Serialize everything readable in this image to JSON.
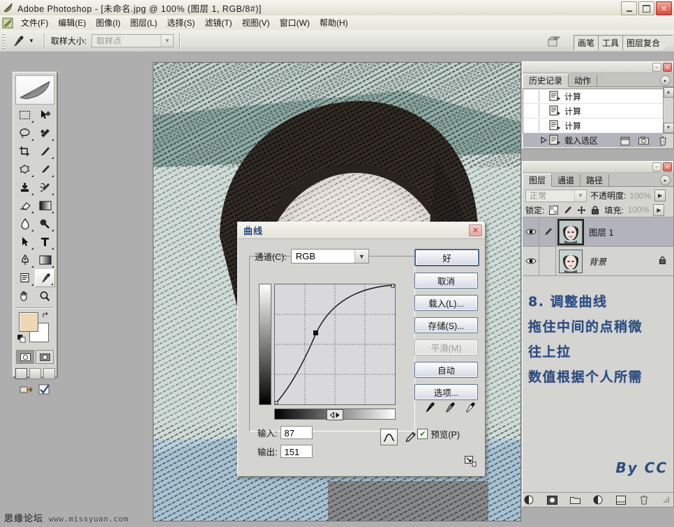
{
  "window": {
    "title": "Adobe Photoshop - [未命名.jpg @ 100% (图层 1, RGB/8#)]",
    "app_icon": "photoshop-feather-icon",
    "buttons": {
      "minimize": "minimize-icon",
      "maximize": "maximize-icon",
      "close": "close-icon"
    }
  },
  "menubar": {
    "items": [
      {
        "label": "文件(F)"
      },
      {
        "label": "编辑(E)"
      },
      {
        "label": "图像(I)"
      },
      {
        "label": "图层(L)"
      },
      {
        "label": "选择(S)"
      },
      {
        "label": "滤镜(T)"
      },
      {
        "label": "视图(V)"
      },
      {
        "label": "窗口(W)"
      },
      {
        "label": "帮助(H)"
      }
    ]
  },
  "options_bar": {
    "tool_icon": "eyedropper-icon",
    "sample_size_label": "取样大小:",
    "sample_size_value": "取样点",
    "palette_well": [
      "画笔",
      "工具",
      "图层复合"
    ]
  },
  "toolbox": {
    "tools": [
      "marquee-rectangular-icon",
      "move-icon",
      "lasso-icon",
      "magic-wand-icon",
      "crop-icon",
      "slice-icon",
      "healing-brush-icon",
      "brush-icon",
      "clone-stamp-icon",
      "history-brush-icon",
      "eraser-icon",
      "gradient-icon",
      "blur-icon",
      "dodge-icon",
      "path-selection-icon",
      "type-icon",
      "pen-icon",
      "shape-rectangle-icon",
      "notes-icon",
      "eyedropper-icon",
      "hand-icon",
      "zoom-icon"
    ],
    "selected_tool": "eyedropper-icon",
    "foreground_color": "#efd7b6",
    "background_color": "#ffffff",
    "swap_colors_icon": "swap-colors-icon",
    "default_colors_icon": "default-colors-icon",
    "quick_mask": [
      "standard-mode-icon",
      "quick-mask-mode-icon"
    ],
    "screen_modes": [
      "standard-screen-icon",
      "full-screen-menubar-icon",
      "full-screen-icon"
    ],
    "jump_to": [
      "jump-to-imageready-icon",
      "jump-to-check-icon"
    ]
  },
  "history_palette": {
    "tabs": [
      {
        "label": "历史记录",
        "active": true
      },
      {
        "label": "动作",
        "active": false
      }
    ],
    "menu_icon": "palette-menu-icon",
    "items": [
      {
        "label": "计算",
        "selected": false,
        "icon": "history-state-icon"
      },
      {
        "label": "计算",
        "selected": false,
        "icon": "history-state-icon"
      },
      {
        "label": "计算",
        "selected": false,
        "icon": "history-state-icon"
      },
      {
        "label": "载入选区",
        "selected": true,
        "icon": "history-state-icon"
      }
    ],
    "footer_icons": [
      "new-document-from-state-icon",
      "new-snapshot-icon",
      "delete-state-icon"
    ]
  },
  "layers_palette": {
    "tabs": [
      {
        "label": "图层",
        "active": true
      },
      {
        "label": "通道",
        "active": false
      },
      {
        "label": "路径",
        "active": false
      }
    ],
    "menu_icon": "palette-menu-icon",
    "blend_mode": "正常",
    "opacity_label": "不透明度:",
    "opacity_value": "100%",
    "lock_label": "锁定:",
    "lock_icons": [
      "lock-transparency-icon",
      "lock-image-icon",
      "lock-position-icon",
      "lock-all-icon"
    ],
    "fill_label": "填充:",
    "fill_value": "100%",
    "layers": [
      {
        "name": "图层 1",
        "selected": true,
        "visible": true,
        "has_brush_icon": true,
        "locked": false,
        "italic": false
      },
      {
        "name": "背景",
        "selected": false,
        "visible": true,
        "has_brush_icon": false,
        "locked": true,
        "italic": true
      }
    ],
    "footer_icons": [
      "layer-style-icon",
      "layer-mask-icon",
      "new-group-icon",
      "adjustment-layer-icon",
      "new-layer-icon",
      "delete-layer-icon"
    ]
  },
  "annotation": {
    "lines": [
      "8. 调整曲线",
      "拖住中间的点稍微",
      "往上拉",
      "数值根据个人所需"
    ],
    "signature": "By  CC",
    "color": "#2b4c82"
  },
  "curves_dialog": {
    "title": "曲线",
    "close_icon": "close-icon",
    "channel_label": "通道(C):",
    "channel_value": "RGB",
    "input_label": "输入:",
    "input_value": "87",
    "output_label": "输出:",
    "output_value": "151",
    "curve_tool_icon": "curve-tool-icon",
    "pencil_tool_icon": "pencil-tool-icon",
    "gradient_toggle_icon": "gradient-direction-toggle-icon",
    "buttons": [
      {
        "label": "好",
        "primary": true,
        "disabled": false
      },
      {
        "label": "取消",
        "primary": false,
        "disabled": false
      },
      {
        "label": "载入(L)...",
        "primary": false,
        "disabled": false
      },
      {
        "label": "存储(S)...",
        "primary": false,
        "disabled": false
      },
      {
        "label": "平滑(M)",
        "primary": false,
        "disabled": true
      },
      {
        "label": "自动",
        "primary": false,
        "disabled": false
      },
      {
        "label": "选项...",
        "primary": false,
        "disabled": false
      }
    ],
    "eyedroppers": [
      "black-point-eyedropper-icon",
      "gray-point-eyedropper-icon",
      "white-point-eyedropper-icon"
    ],
    "preview_label": "预览(P)",
    "preview_checked": true,
    "resize_grip_icon": "resize-grip-icon",
    "curve_points": [
      {
        "input": 0,
        "output": 0
      },
      {
        "input": 87,
        "output": 151
      },
      {
        "input": 255,
        "output": 255
      }
    ],
    "grid_divisions": 4
  },
  "watermark": {
    "site_cn": "思缘论坛",
    "site_url": "www.missyuan.com"
  }
}
